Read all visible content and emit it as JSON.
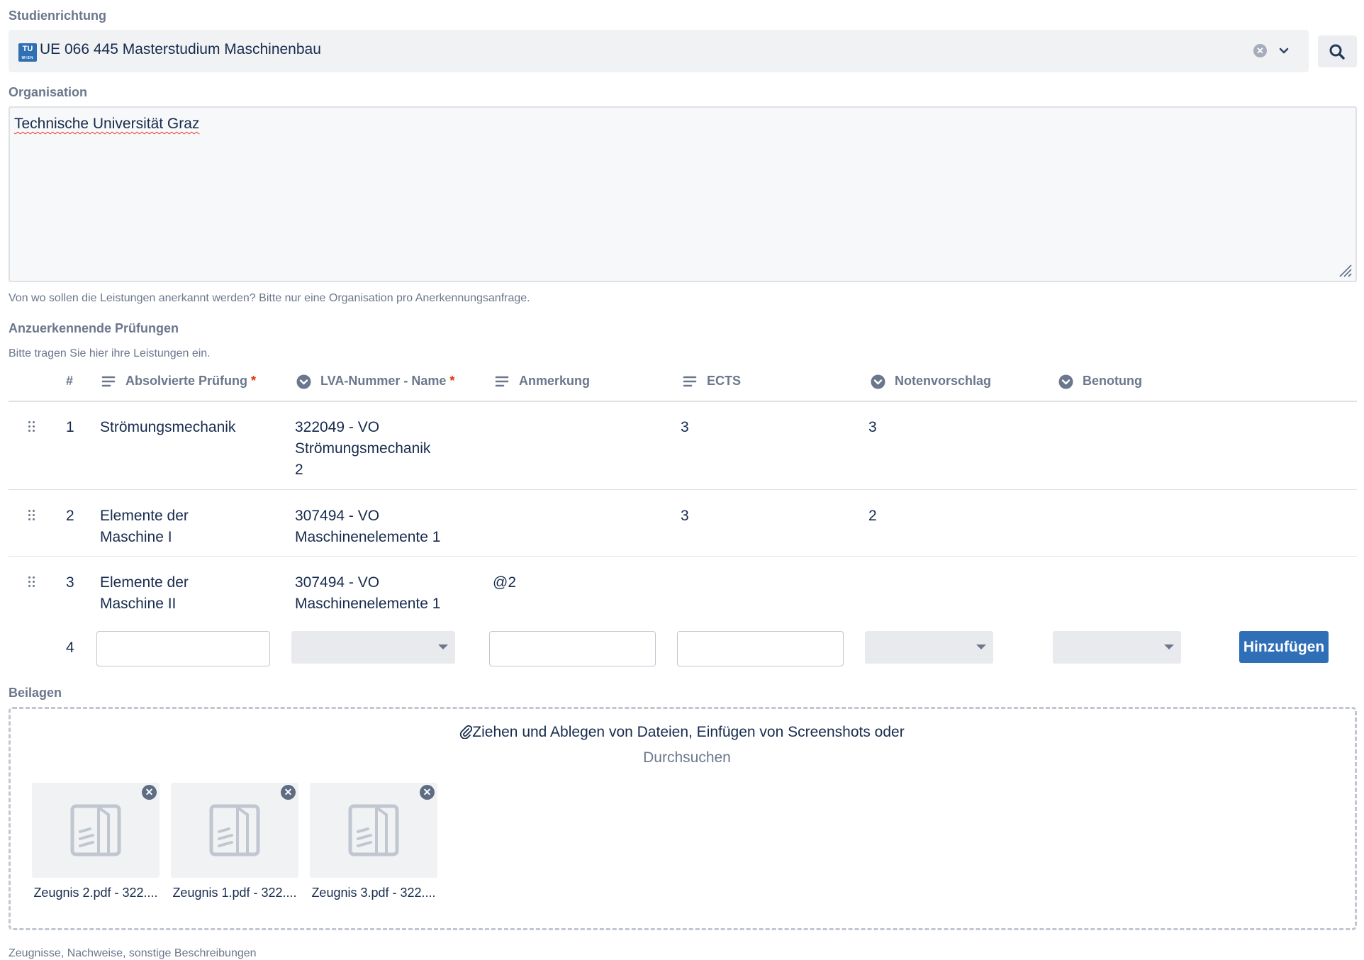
{
  "study": {
    "label": "Studienrichtung",
    "logo_text": "TU",
    "logo_subtext": "WIEN",
    "value": "UE 066 445 Masterstudium Maschinenbau",
    "clear_glyph": "✕"
  },
  "organisation": {
    "label": "Organisation",
    "value": "Technische Universität Graz",
    "help": "Von wo sollen die Leistungen anerkannt werden? Bitte nur eine Organisation pro Anerkennungsanfrage."
  },
  "exams": {
    "label": "Anzuerkennende Prüfungen",
    "help": "Bitte tragen Sie hier ihre Leistungen ein.",
    "columns": {
      "index": "#",
      "completed": "Absolvierte Prüfung",
      "lva": "LVA-Nummer - Name",
      "note": "Anmerkung",
      "ects": "ECTS",
      "grade_suggestion": "Notenvorschlag",
      "grading": "Benotung",
      "required_mark": "*"
    },
    "rows": [
      {
        "index": "1",
        "completed_lines": [
          "Strömungsmechanik"
        ],
        "lva_lines": [
          "322049 - VO",
          "Strömungsmechanik",
          "2"
        ],
        "note": "",
        "ects": "3",
        "grade_suggestion": "3",
        "grading": ""
      },
      {
        "index": "2",
        "completed_lines": [
          "Elemente der",
          "Maschine I"
        ],
        "lva_lines": [
          "307494 - VO",
          "Maschinenelemente 1"
        ],
        "note": "",
        "ects": "3",
        "grade_suggestion": "2",
        "grading": ""
      },
      {
        "index": "3",
        "completed_lines": [
          "Elemente der",
          "Maschine II"
        ],
        "lva_lines": [
          "307494 - VO",
          "Maschinenelemente 1"
        ],
        "note": "@2",
        "ects": "",
        "grade_suggestion": "",
        "grading": ""
      }
    ],
    "new_row_index": "4",
    "add_button": "Hinzufügen"
  },
  "attachments": {
    "label": "Beilagen",
    "drop_text": "Ziehen und Ablegen von Dateien, Einfügen von Screenshots oder",
    "browse": "Durchsuchen",
    "files": [
      {
        "name": "Zeugnis 2.pdf - 322...."
      },
      {
        "name": "Zeugnis 1.pdf - 322...."
      },
      {
        "name": "Zeugnis 3.pdf - 322...."
      }
    ],
    "help": "Zeugnisse, Nachweise, sonstige Beschreibungen"
  },
  "colors": {
    "accent": "#2e6fb7",
    "required": "#de350b",
    "muted": "#6b778c",
    "text": "#172b4d"
  },
  "icons": [
    "tu-wien-logo-icon",
    "clear-icon",
    "chevron-down-icon",
    "search-icon",
    "resize-handle-icon",
    "text-field-icon",
    "dropdown-field-icon",
    "drag-handle-icon",
    "paperclip-icon",
    "document-icon",
    "remove-file-icon"
  ]
}
